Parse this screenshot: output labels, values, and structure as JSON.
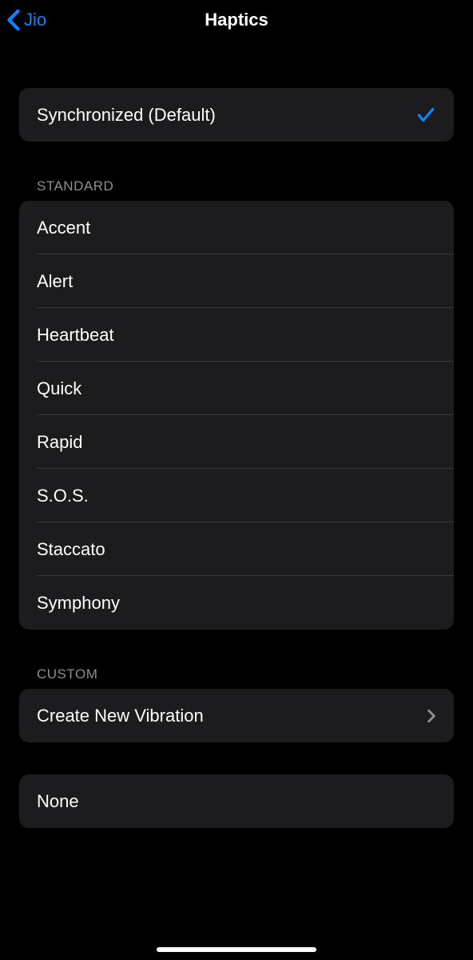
{
  "nav": {
    "back_label": "Jio",
    "title": "Haptics"
  },
  "default_group": {
    "item": {
      "label": "Synchronized (Default)",
      "selected": true
    }
  },
  "standard": {
    "header": "Standard",
    "items": [
      {
        "label": "Accent"
      },
      {
        "label": "Alert"
      },
      {
        "label": "Heartbeat"
      },
      {
        "label": "Quick"
      },
      {
        "label": "Rapid"
      },
      {
        "label": "S.O.S."
      },
      {
        "label": "Staccato"
      },
      {
        "label": "Symphony"
      }
    ]
  },
  "custom": {
    "header": "Custom",
    "create_label": "Create New Vibration"
  },
  "none": {
    "label": "None"
  }
}
